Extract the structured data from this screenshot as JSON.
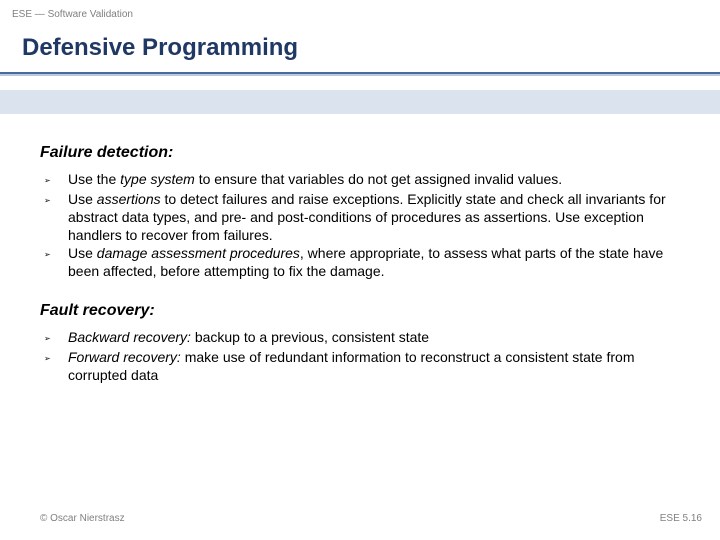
{
  "header": {
    "topic": "ESE — Software Validation"
  },
  "title": "Defensive Programming",
  "sections": {
    "failure": {
      "heading": "Failure detection:",
      "bullets": [
        {
          "pre": "Use the ",
          "em": "type system",
          "post": " to ensure that variables do not get assigned invalid values."
        },
        {
          "pre": "Use ",
          "em": "assertions",
          "post": " to detect failures and raise exceptions. Explicitly state and check all invariants for abstract data types, and pre- and post-conditions of procedures as assertions. Use exception handlers to recover from failures."
        },
        {
          "pre": "Use ",
          "em": "damage assessment procedures",
          "post": ", where appropriate, to assess what parts of the state have been affected, before attempting to fix the damage."
        }
      ]
    },
    "recovery": {
      "heading": "Fault recovery:",
      "bullets": [
        {
          "em": "Backward recovery:",
          "post": " backup to a previous, consistent state"
        },
        {
          "em": "Forward recovery:",
          "post": " make use of redundant information to reconstruct a consistent state from corrupted data"
        }
      ]
    }
  },
  "footer": {
    "copyright": "© Oscar Nierstrasz",
    "pagenum": "ESE 5.16"
  },
  "glyph": {
    "bullet": "➢"
  }
}
